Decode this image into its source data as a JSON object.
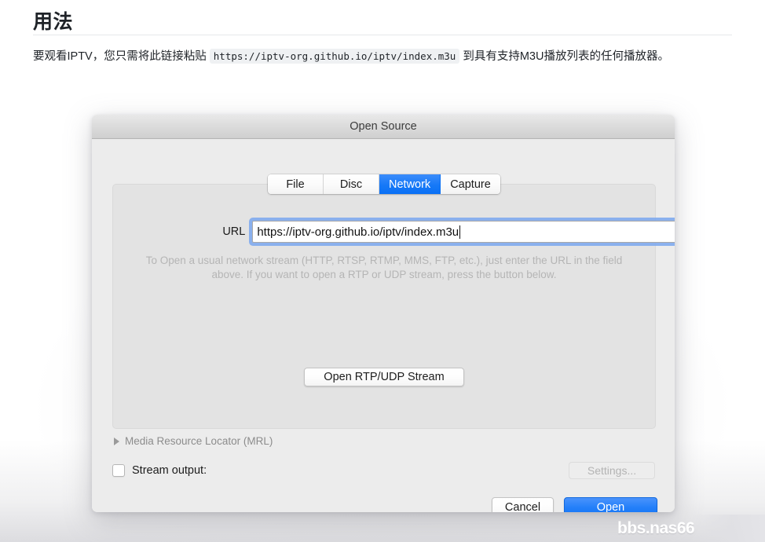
{
  "doc": {
    "title": "用法",
    "paragraph_before": "要观看IPTV，您只需将此链接粘贴 ",
    "code_url": "https://iptv-org.github.io/iptv/index.m3u",
    "paragraph_after": " 到具有支持M3U播放列表的任何播放器。"
  },
  "watermark": {
    "text": "bbs.nas66"
  },
  "dialog": {
    "title": "Open Source",
    "tabs": [
      {
        "label": "File",
        "active": false
      },
      {
        "label": "Disc",
        "active": false
      },
      {
        "label": "Network",
        "active": true
      },
      {
        "label": "Capture",
        "active": false
      }
    ],
    "url": {
      "label": "URL",
      "value": "https://iptv-org.github.io/iptv/index.m3u",
      "placeholder": ""
    },
    "hint": "To Open a usual network stream (HTTP, RTSP, RTMP, MMS, FTP, etc.), just enter the URL in the field above. If you want to open a RTP or UDP stream, press the button below.",
    "rtp_button": "Open RTP/UDP Stream",
    "mrl": {
      "label": "Media Resource Locator (MRL)",
      "expanded": false
    },
    "stream_output": {
      "label": "Stream output:",
      "checked": false
    },
    "settings_button": {
      "label": "Settings...",
      "disabled": true
    },
    "cancel_button": "Cancel",
    "open_button": "Open",
    "colors": {
      "accent": "#1679f7",
      "focus_ring": "#7aa7ef",
      "dialog_bg": "#ececec",
      "panel_bg": "#e3e3e3"
    }
  }
}
